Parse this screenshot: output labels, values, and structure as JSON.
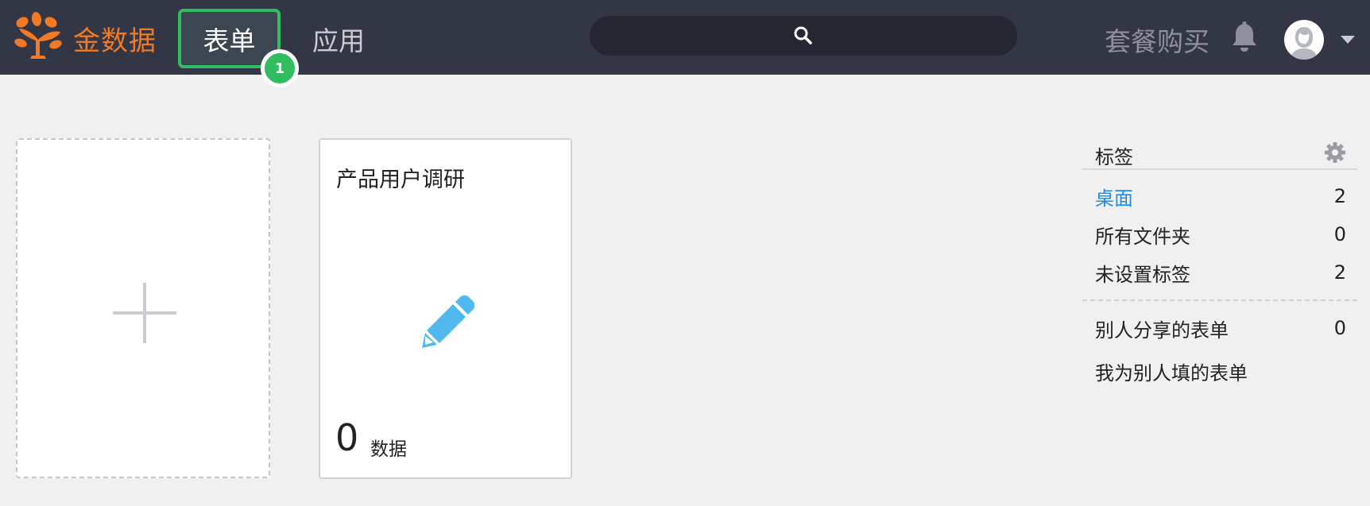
{
  "brand": {
    "name": "金数据",
    "logo_icon": "tree-logo-icon",
    "brand_color": "#f07a25"
  },
  "nav": {
    "tabs": [
      {
        "label": "表单",
        "active": true
      },
      {
        "label": "应用",
        "active": false
      }
    ],
    "badge": "1"
  },
  "search": {
    "icon": "search-icon",
    "placeholder": ""
  },
  "header_right": {
    "buy_label": "套餐购买",
    "bell_icon": "bell-icon",
    "avatar_icon": "avatar-icon",
    "menu_icon": "caret-down-icon"
  },
  "cards": {
    "new_card_icon": "plus-icon",
    "forms": [
      {
        "title": "产品用户调研",
        "icon": "pencil-icon",
        "count": "0",
        "count_label": "数据"
      }
    ]
  },
  "sidebar": {
    "title": "标签",
    "settings_icon": "gear-icon",
    "items": [
      {
        "label": "桌面",
        "count": "2",
        "active": true
      },
      {
        "label": "所有文件夹",
        "count": "0"
      },
      {
        "label": "未设置标签",
        "count": "2"
      }
    ],
    "shared_items": [
      {
        "label": "别人分享的表单",
        "count": "0"
      },
      {
        "label": "我为别人填的表单",
        "count": ""
      }
    ]
  },
  "colors": {
    "header_bg": "#323645",
    "accent_green": "#2fbd5f",
    "link_blue": "#1b8ce8",
    "pencil_blue": "#4fb9ef"
  }
}
